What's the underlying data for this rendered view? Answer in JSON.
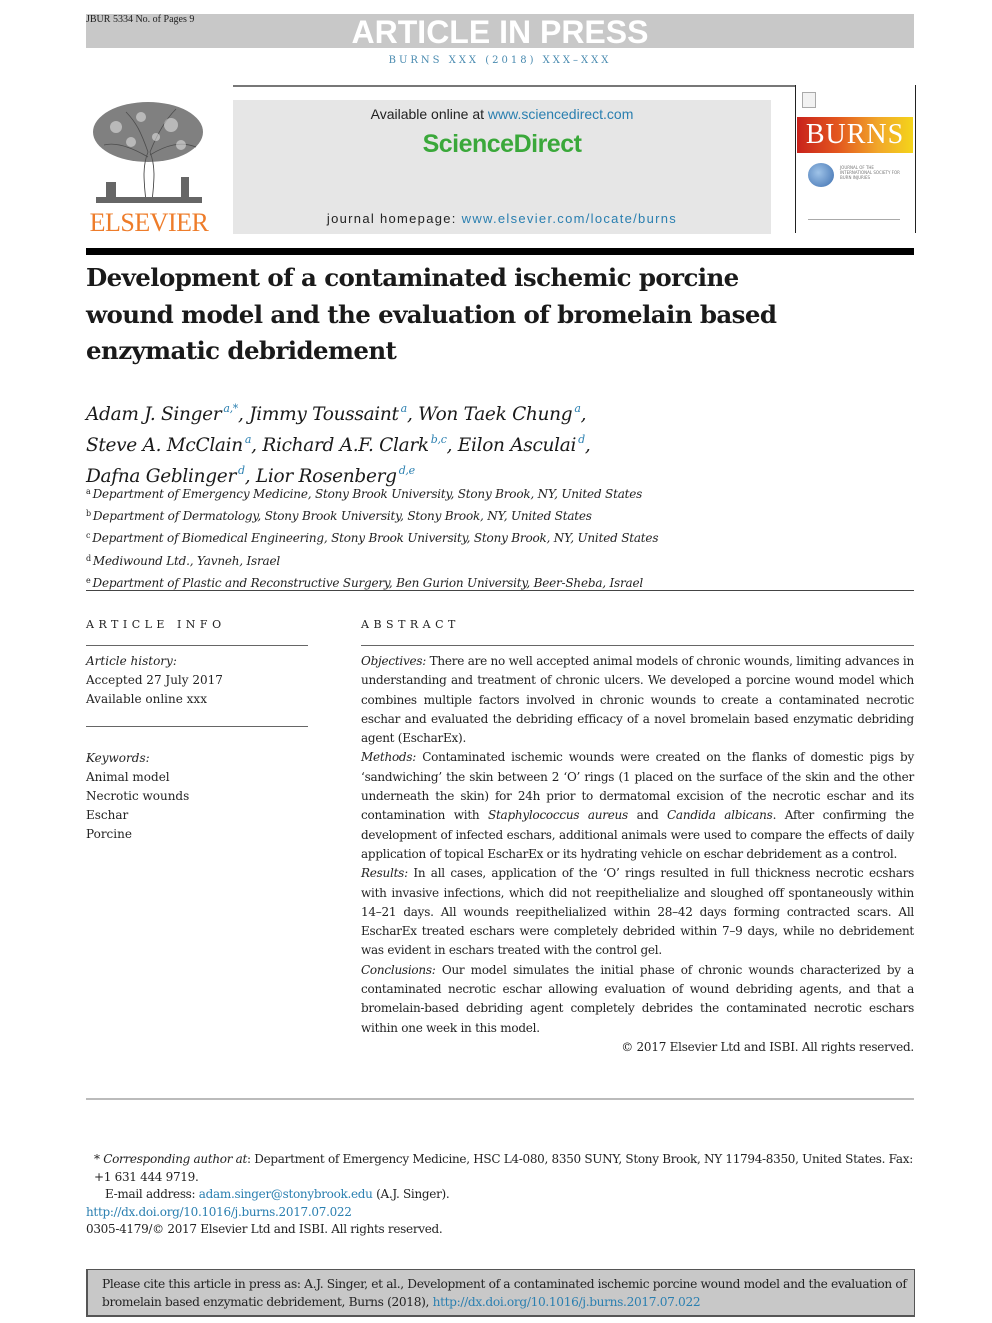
{
  "banner": {
    "manuscript_id": "JBUR 5334 No. of Pages 9",
    "status": "ARTICLE IN PRESS",
    "journal_line": "BURNS XXX (2018) XXX–XXX"
  },
  "header": {
    "publisher_logo_text": "ELSEVIER",
    "available_online_prefix": "Available online at ",
    "sciencedirect_url": "www.sciencedirect.com",
    "sciencedirect_brand": "ScienceDirect",
    "homepage_prefix": "journal homepage: ",
    "homepage_url": "www.elsevier.com/locate/burns",
    "cover_title": "BURNS",
    "cover_subtext": "JOURNAL OF THE INTERNATIONAL SOCIETY FOR BURN INJURIES",
    "cover_badge": "ISBI"
  },
  "article": {
    "title": "Development of a contaminated ischemic porcine wound model and the evaluation of bromelain based enzymatic debridement",
    "authors": [
      {
        "name": "Adam J. Singer",
        "sup": "a,*",
        "sep": ", "
      },
      {
        "name": "Jimmy Toussaint",
        "sup": "a",
        "sep": ", "
      },
      {
        "name": "Won Taek Chung",
        "sup": "a",
        "sep": ","
      },
      {
        "name": "Steve A. McClain",
        "sup": "a",
        "sep": ", "
      },
      {
        "name": "Richard A.F. Clark",
        "sup": "b,c",
        "sep": ", "
      },
      {
        "name": "Eilon Asculai",
        "sup": "d",
        "sep": ","
      },
      {
        "name": "Dafna Geblinger",
        "sup": "d",
        "sep": ", "
      },
      {
        "name": "Lior Rosenberg",
        "sup": "d,e",
        "sep": ""
      }
    ],
    "affiliations": [
      {
        "key": "a",
        "text": "Department of Emergency Medicine, Stony Brook University, Stony Brook, NY, United States"
      },
      {
        "key": "b",
        "text": "Department of Dermatology, Stony Brook University, Stony Brook, NY, United States"
      },
      {
        "key": "c",
        "text": "Department of Biomedical Engineering, Stony Brook University, Stony Brook, NY, United States"
      },
      {
        "key": "d",
        "text": "Mediwound Ltd., Yavneh, Israel"
      },
      {
        "key": "e",
        "text": "Department of Plastic and Reconstructive Surgery, Ben Gurion University, Beer-Sheba, Israel"
      }
    ]
  },
  "article_info": {
    "heading": "ARTICLE INFO",
    "history_label": "Article history:",
    "history": [
      "Accepted 27 July 2017",
      "Available online xxx"
    ],
    "keywords_label": "Keywords:",
    "keywords": [
      "Animal model",
      "Necrotic wounds",
      "Eschar",
      "Porcine"
    ]
  },
  "abstract": {
    "heading": "ABSTRACT",
    "objectives_label": "Objectives:",
    "objectives": " There are no well accepted animal models of chronic wounds, limiting advances in understanding and treatment of chronic ulcers. We developed a porcine wound model which combines multiple factors involved in chronic wounds to create a contaminated necrotic eschar and evaluated the debriding efficacy of a novel bromelain based enzymatic debriding agent (EscharEx).",
    "methods_label": "Methods:",
    "methods_a": " Contaminated ischemic wounds were created on the flanks of domestic pigs by ‘sandwiching’ the skin between 2 ‘O’ rings (1 placed on the surface of the skin and the other underneath the skin) for 24h prior to dermatomal excision of the necrotic eschar and its contamination with ",
    "methods_org1": "Staphylococcus aureus",
    "methods_and": " and ",
    "methods_org2": "Candida albicans",
    "methods_b": ". After confirming the development of infected eschars, additional animals were used to compare the effects of daily application of topical EscharEx or its hydrating vehicle on eschar debridement as a control.",
    "results_label": "Results:",
    "results": " In all cases, application of the ‘O’ rings resulted in full thickness necrotic ecshars with invasive infections, which did not reepithelialize and sloughed off spontaneously within 14–21 days. All wounds reepithelialized within 28–42 days forming contracted scars. All EscharEx treated eschars were completely debrided within 7–9 days, while no debridement was evident in eschars treated with the control gel.",
    "conclusions_label": "Conclusions:",
    "conclusions": " Our model simulates the initial phase of chronic wounds characterized by a contaminated necrotic eschar allowing evaluation of wound debriding agents, and that a bromelain-based debriding agent completely debrides the contaminated necrotic eschars within one week in this model.",
    "copyright": "© 2017 Elsevier Ltd and ISBI. All rights reserved."
  },
  "footnotes": {
    "star": "*",
    "corresponding_label": "Corresponding author at",
    "corresponding_text": ": Department of Emergency Medicine, HSC L4-080, 8350 SUNY, Stony Brook, NY 11794-8350, United States. Fax: +1 631 444 9719.",
    "email_label": "E-mail address: ",
    "email": "adam.singer@stonybrook.edu",
    "email_suffix": " (A.J.  Singer).",
    "doi": "http://dx.doi.org/10.1016/j.burns.2017.07.022",
    "issn_line": "0305-4179/© 2017 Elsevier Ltd and ISBI. All rights reserved."
  },
  "citation": {
    "text": "Please cite this article in press as: A.J. Singer, et al., Development of a contaminated ischemic porcine wound model and the evaluation of bromelain based enzymatic debridement, Burns (2018), ",
    "doi": "http://dx.doi.org/10.1016/j.burns.2017.07.022"
  },
  "colors": {
    "link": "#2a7fb0",
    "sciencedirect_green": "#3aa83a",
    "elsevier_orange": "#ee7c2a",
    "banner_gray": "#c8c8c8"
  }
}
